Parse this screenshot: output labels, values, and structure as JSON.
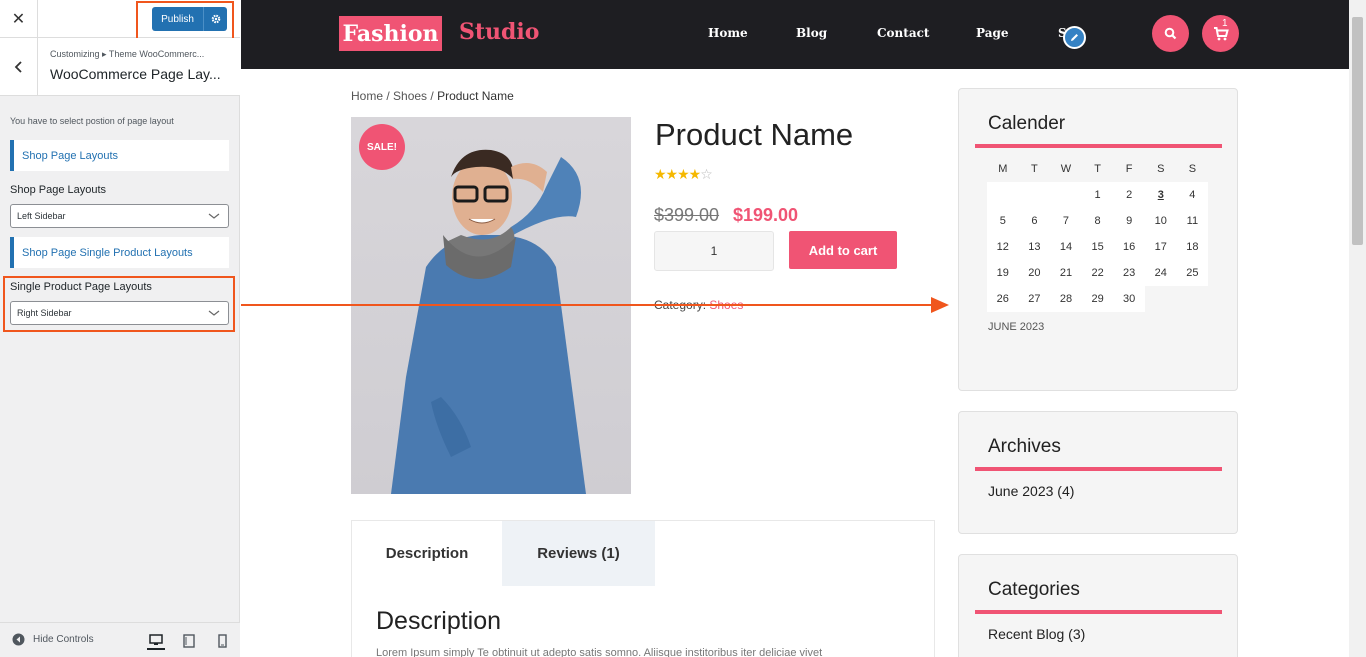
{
  "customizer": {
    "close_icon": "close-icon",
    "publish_label": "Publish",
    "breadcrumb": "Customizing ▸ Theme WooCommerc...",
    "title": "WooCommerce Page Lay...",
    "note": "You have to select postion of page layout",
    "section_shop": "Shop Page Layouts",
    "shop_label": "Shop Page Layouts",
    "shop_value": "Left Sidebar",
    "section_single": "Shop Page Single Product Layouts",
    "single_label": "Single Product Page Layouts",
    "single_value": "Right Sidebar",
    "hide_controls": "Hide Controls"
  },
  "site": {
    "logo_part1": "Fashion",
    "logo_part2": "Studio",
    "nav": [
      "Home",
      "Blog",
      "Contact",
      "Page",
      "S"
    ],
    "cart_count": "1"
  },
  "breadcrumb": {
    "home": "Home",
    "sep": " / ",
    "shoes": "Shoes",
    "current": "Product Name"
  },
  "product": {
    "sale_badge": "SALE!",
    "title": "Product Name",
    "rating": 4,
    "rating_max": 5,
    "old_price": "$399.00",
    "new_price": "$199.00",
    "quantity": "1",
    "add_to_cart": "Add to cart",
    "category_label": "Category:",
    "category_value": "Shoes"
  },
  "tabs": {
    "description": "Description",
    "reviews": "Reviews (1)"
  },
  "description": {
    "heading": "Description",
    "text": "Lorem Ipsum simply Te obtinuit ut adepto satis somno. Aliisque institoribus iter deliciae vivet"
  },
  "widgets": {
    "calendar": {
      "title": "Calender",
      "days": [
        "M",
        "T",
        "W",
        "T",
        "F",
        "S",
        "S"
      ],
      "rows": [
        [
          "",
          "",
          "",
          "1",
          "2",
          "3",
          "4"
        ],
        [
          "5",
          "6",
          "7",
          "8",
          "9",
          "10",
          "11"
        ],
        [
          "12",
          "13",
          "14",
          "15",
          "16",
          "17",
          "18"
        ],
        [
          "19",
          "20",
          "21",
          "22",
          "23",
          "24",
          "25"
        ],
        [
          "26",
          "27",
          "28",
          "29",
          "30",
          "",
          ""
        ]
      ],
      "today": "3",
      "month": "JUNE 2023"
    },
    "archives": {
      "title": "Archives",
      "item": "June 2023 (4)"
    },
    "categories": {
      "title": "Categories",
      "item": "Recent Blog (3)"
    }
  },
  "colors": {
    "accent": "#f05474",
    "publish": "#2271b1",
    "highlight": "#f0561d",
    "header_bg": "#1e1e22"
  }
}
